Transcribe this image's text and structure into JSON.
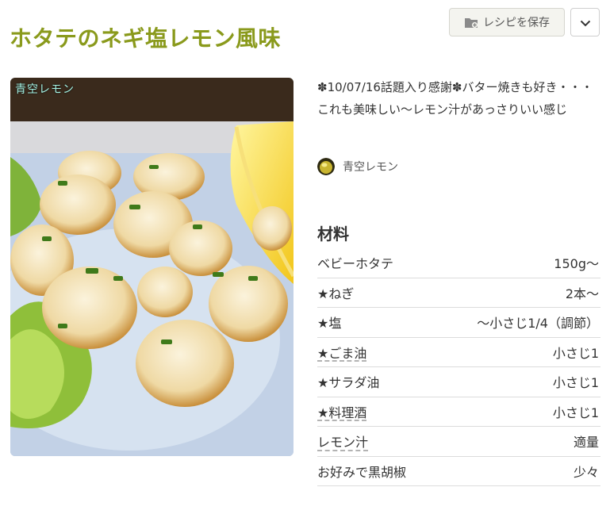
{
  "recipe": {
    "title": "ホタテのネギ塩レモン風味",
    "save_label": "レシピを保存",
    "photo_watermark": "青空レモン",
    "description": "✽10/07/16話題入り感謝✽バター焼きも好き・・・これも美味しい～レモン汁があっさりいい感じ",
    "author": "青空レモン"
  },
  "ingredients": {
    "heading": "材料",
    "items": [
      {
        "name": "ベビーホタテ",
        "qty": "150g～",
        "linked": false
      },
      {
        "name": "★ねぎ",
        "qty": "2本～",
        "linked": false
      },
      {
        "name": "★塩",
        "qty": "～小さじ1/4（調節）",
        "linked": false
      },
      {
        "name": "★ごま油",
        "qty": "小さじ1",
        "linked": true
      },
      {
        "name": "★サラダ油",
        "qty": "小さじ1",
        "linked": false
      },
      {
        "name": "★料理酒",
        "qty": "小さじ1",
        "linked": true
      },
      {
        "name": "レモン汁",
        "qty": "適量",
        "linked": true
      },
      {
        "name": "お好みで黒胡椒",
        "qty": "少々",
        "linked": false
      }
    ]
  },
  "icons": {
    "save": "folder-plus-icon",
    "toggle": "chevron-down-icon"
  },
  "colors": {
    "title": "#8a9a1c"
  }
}
